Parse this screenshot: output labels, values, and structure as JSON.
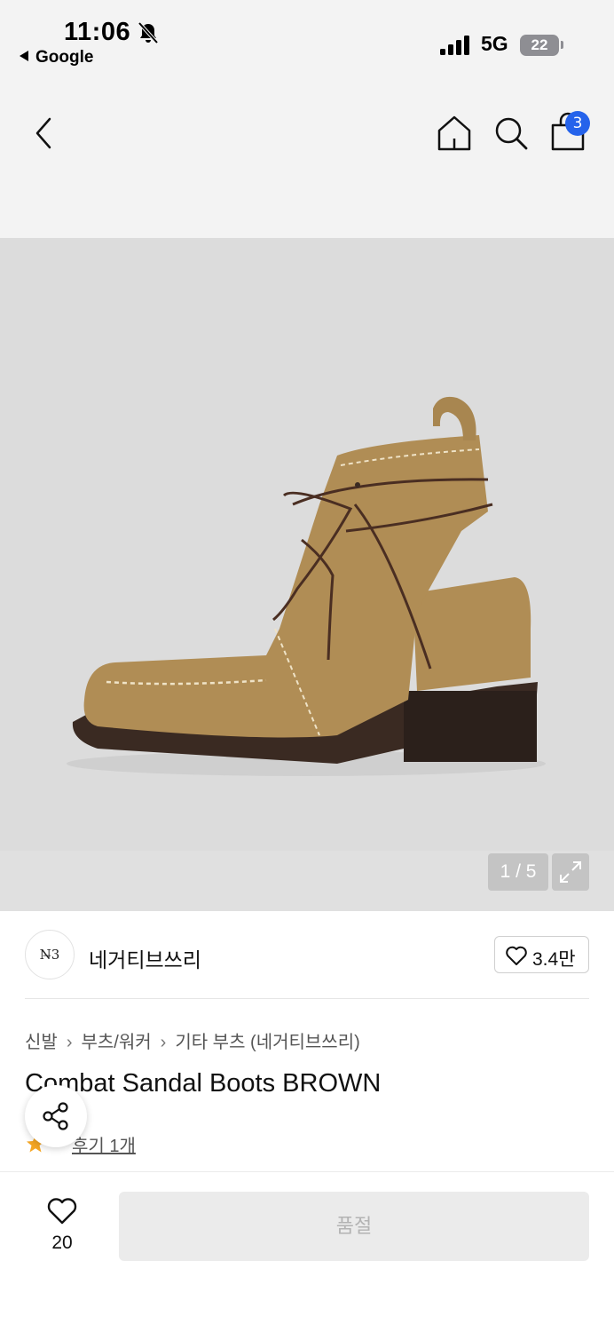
{
  "status_bar": {
    "time": "11:06",
    "back_app": "Google",
    "network": "5G",
    "battery": "22"
  },
  "header": {
    "cart_count": "3"
  },
  "gallery": {
    "counter": "1 / 5",
    "colors": {
      "background": "#dcdcdc",
      "boot": "#b08d55",
      "sole": "#3a2a22",
      "lace": "#4a2e22"
    }
  },
  "brand": {
    "logo_text": "N̶3",
    "name": "네거티브쓰리",
    "like_count": "3.4만"
  },
  "product": {
    "breadcrumb": [
      "신발",
      "부츠/워커",
      "기타 부츠 (네거티브쓰리)"
    ],
    "title": "Combat Sandal Boots BROWN",
    "rating": "5",
    "review_link": "후기 1개"
  },
  "bottom_bar": {
    "wish_count": "20",
    "action_label": "품절"
  },
  "colors": {
    "accent_badge": "#2563eb",
    "star": "#f5a623",
    "disabled_button": "#ebebeb"
  }
}
